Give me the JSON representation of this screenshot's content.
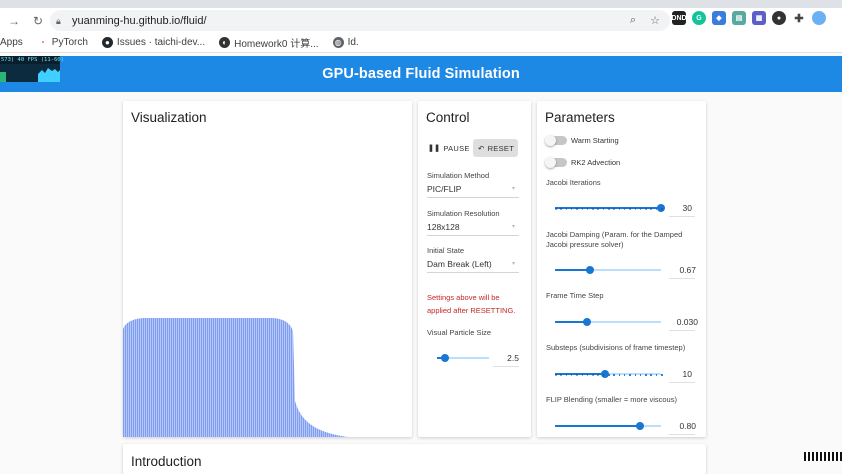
{
  "browser": {
    "url": "yuanming-hu.github.io/fluid/",
    "bookmarks": [
      {
        "label": "Apps",
        "icon": "apps-grid-icon",
        "color": "#5f6368"
      },
      {
        "label": "PyTorch",
        "icon": "pytorch-icon",
        "color": "#ee4c2c"
      },
      {
        "label": "Issues · taichi-dev...",
        "icon": "github-icon",
        "color": "#24292e"
      },
      {
        "label": "Homework0 计算...",
        "icon": "page-icon",
        "color": "#333333"
      },
      {
        "label": "Id.",
        "icon": "globe-icon",
        "color": "#5f6368"
      }
    ]
  },
  "fps_meter": {
    "text": "573) 40 FPS (11-60)"
  },
  "app": {
    "title": "GPU-based Fluid Simulation",
    "accent": "#1e88e5"
  },
  "visualization": {
    "title": "Visualization"
  },
  "control": {
    "title": "Control",
    "pause_label": "PAUSE",
    "reset_label": "RESET",
    "fields": [
      {
        "label": "Simulation Method",
        "value": "PIC/FLIP"
      },
      {
        "label": "Simulation Resolution",
        "value": "128x128"
      },
      {
        "label": "Initial State",
        "value": "Dam Break (Left)"
      }
    ],
    "note_line1": "Settings above will be",
    "note_line2": "applied after RESETTING.",
    "particle_size": {
      "label": "Visual Particle Size",
      "value": "2.5",
      "fraction": 0.15
    }
  },
  "parameters": {
    "title": "Parameters",
    "switches": [
      {
        "label": "Warm Starting",
        "on": false
      },
      {
        "label": "RK2 Advection",
        "on": false
      }
    ],
    "sliders": [
      {
        "label": "Jacobi Iterations",
        "value": "30",
        "fraction": 1.0,
        "ticks": true
      },
      {
        "label_line1": "Jacobi Damping (Param. for the Damped",
        "label_line2": "Jacobi pressure solver)",
        "value": "0.67",
        "fraction": 0.33,
        "ticks": false
      },
      {
        "label": "Frame Time Step",
        "value": "0.030",
        "fraction": 0.3,
        "ticks": false
      },
      {
        "label": "Substeps (subdivisions of frame timestep)",
        "value": "10",
        "fraction": 0.47,
        "ticks": true
      },
      {
        "label": "FLIP Blending (smaller = more viscous)",
        "value": "0.80",
        "fraction": 0.8,
        "ticks": false
      }
    ]
  },
  "intro": {
    "title": "Introduction"
  }
}
